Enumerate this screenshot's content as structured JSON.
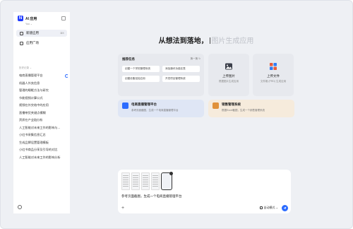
{
  "app": {
    "title": "AI 应用",
    "user": "Yoo ⌄",
    "logo_letter": "N"
  },
  "sidebar": {
    "nav": [
      {
        "label": "新建应用",
        "shortcut": "⌘K",
        "icon": "new-app-icon"
      },
      {
        "label": "应用广场",
        "icon": "app-plaza-icon"
      }
    ],
    "history_header": "历史记录 ⌄",
    "history": [
      "电商直播管理平台",
      "机器人外卖信息",
      "管理的睡眠方法与研究",
      "节能视频计算公式",
      "视频在外交结中的应用",
      "直播带货关键点模糊",
      "资质在产业链分析",
      "人工智能对未来工作的影响与...",
      "小红书采集信息汇总",
      "生成品牌设置管理模板",
      "小红书商品分享及引导的对比",
      "人工智能对未来工作的影响分析"
    ]
  },
  "main": {
    "headline_strong": "从想法到落地，",
    "headline_faint": "图片生成应用",
    "tasks": {
      "title": "推荐任务",
      "refresh": "换一换 ↻",
      "items": [
        "创建一个学校管理系统",
        "添加通讯功能名表",
        "创建设备巡检应用",
        "开发项目管理系统"
      ]
    },
    "upload_image": {
      "label": "上传图片",
      "sub": "根据图片生成应用",
      "icon": "image-upload-icon"
    },
    "upload_file": {
      "label": "上传文件",
      "sub": "文件格 (PRD) 生成应用",
      "icon": "file-upload-icon"
    },
    "modes": [
      {
        "title": "电商直播管理平台",
        "desc": "参考页面截图，生成一个电商直播管理平台"
      },
      {
        "title": "销售管理系统",
        "desc": "根据Excel截图，生成一个销售管理系统"
      }
    ]
  },
  "composer": {
    "text": "参考页面截图，生成一个电商直播管理平台",
    "add": "+",
    "mode_select": "自动模式 ⌄"
  },
  "colors": {
    "accent": "#2b6bff",
    "brand": "#1f3bff"
  }
}
